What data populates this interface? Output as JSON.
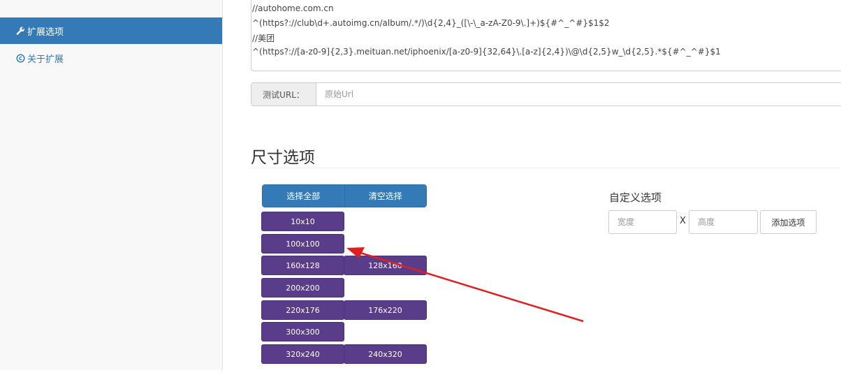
{
  "sidebar": {
    "items": [
      {
        "label": "扩展选项",
        "icon": "wrench-icon",
        "active": true
      },
      {
        "label": "关于扩展",
        "icon": "copyright-icon",
        "active": false
      }
    ]
  },
  "regex_rules": {
    "lines": [
      "//autohome.com.cn",
      "^(https?://club\\d+.autoimg.cn/album/.*/)\\d{2,4}_([\\-\\_a-zA-Z0-9\\.]+)${#^_^#}$1$2",
      "//美团",
      "^(https?://[a-z0-9]{2,3}.meituan.net/iphoenix/[a-z0-9]{32,64}\\.[a-z]{2,4})\\@\\d{2,5}w_\\d{2,5}.*${#^_^#}$1"
    ]
  },
  "test_url": {
    "label": "测试URL：",
    "placeholder": "原始Url"
  },
  "size_section": {
    "title": "尺寸选项",
    "select_all": "选择全部",
    "clear_select": "清空选择",
    "rows": [
      {
        "left": "10x10",
        "right": ""
      },
      {
        "left": "100x100",
        "right": ""
      },
      {
        "left": "160x128",
        "right": "128x160"
      },
      {
        "left": "200x200",
        "right": ""
      },
      {
        "left": "220x176",
        "right": "176x220"
      },
      {
        "left": "300x300",
        "right": ""
      },
      {
        "left": "320x240",
        "right": "240x320"
      }
    ]
  },
  "custom": {
    "title": "自定义选项",
    "width_placeholder": "宽度",
    "separator": "X",
    "height_placeholder": "高度",
    "add_label": "添加选项"
  },
  "colors": {
    "accent": "#337ab7",
    "size_button": "#5a3d8a",
    "annotation_arrow": "#e02020"
  }
}
